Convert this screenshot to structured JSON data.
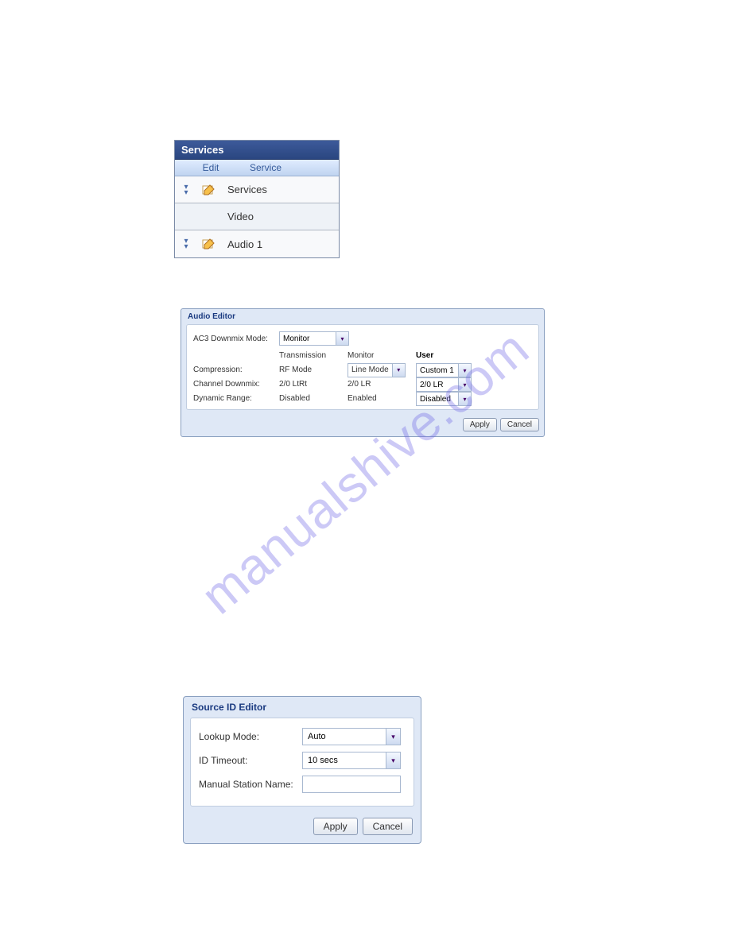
{
  "watermark": "manualshive.com",
  "services": {
    "title": "Services",
    "col_edit": "Edit",
    "col_service": "Service",
    "rows": [
      {
        "label": "Services",
        "has_edit": true
      },
      {
        "label": "Video",
        "has_edit": false
      },
      {
        "label": "Audio 1",
        "has_edit": true
      }
    ]
  },
  "audio_editor": {
    "title": "Audio Editor",
    "ac3_label": "AC3 Downmix Mode:",
    "ac3_value": "Monitor",
    "headers": {
      "transmission": "Transmission",
      "monitor": "Monitor",
      "user": "User"
    },
    "rows": {
      "compression": {
        "label": "Compression:",
        "transmission": "RF Mode",
        "monitor_select": "Line Mode",
        "user_select": "Custom 1"
      },
      "channel_downmix": {
        "label": "Channel Downmix:",
        "transmission": "2/0 LtRt",
        "monitor": "2/0 LR",
        "user_select": "2/0 LR"
      },
      "dynamic_range": {
        "label": "Dynamic Range:",
        "transmission": "Disabled",
        "monitor": "Enabled",
        "user_select": "Disabled"
      }
    },
    "apply": "Apply",
    "cancel": "Cancel"
  },
  "source_id_editor": {
    "title": "Source ID Editor",
    "lookup_label": "Lookup Mode:",
    "lookup_value": "Auto",
    "timeout_label": "ID Timeout:",
    "timeout_value": "10 secs",
    "manual_label": "Manual Station Name:",
    "manual_value": "",
    "apply": "Apply",
    "cancel": "Cancel"
  }
}
